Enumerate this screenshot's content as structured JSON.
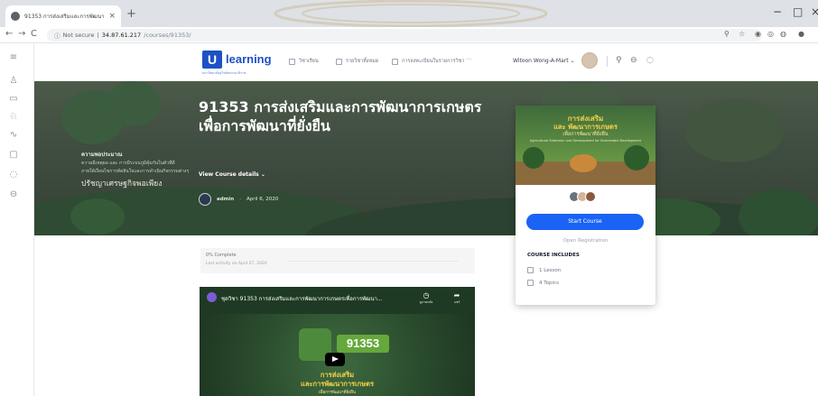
{
  "browser": {
    "tab_title": "91353 การส่งเสริมและการพัฒนาการ",
    "tab_close": "×",
    "new_tab": "+",
    "back": "←",
    "forward": "→",
    "reload": "C",
    "security": "Not secure",
    "url_host": "34.87.61.217",
    "url_path": "/courses/91353/",
    "window": {
      "minimize": "−",
      "maximize": "□",
      "close": "×"
    }
  },
  "header": {
    "logo_letter": "U",
    "logo_word": "learning",
    "logo_sub": "มหาวิทยาลัยสุโขทัยธรรมาธิราช",
    "nav": [
      {
        "label": "วิชาเรียน"
      },
      {
        "label": "รายวิชาทั้งหมด"
      },
      {
        "label": "การลงทะเบียนในรายการวิชา"
      }
    ],
    "more": "···",
    "user_name": "Witoon Wong-A-Mart",
    "user_caret": "⌄"
  },
  "hero": {
    "left_line1": "ความพอประมาณ",
    "left_line2": "ความมีเหตุผล และ การมีระบบภูมิคุ้มกันในตัวที่ดี",
    "left_line3": "ภายใต้เงื่อนไขการตัดสินใจและการดำเนินกิจกรรมต่างๆ",
    "left_line4": "ปรัชญาเศรษฐกิจพอเพียง",
    "title": "91353 การส่งเสริมและการพัฒนาการเกษตรเพื่อการพัฒนาที่ยั่งยืน",
    "view_details": "View Course details",
    "view_caret": "⌄",
    "author": "admin",
    "date_sep": "·",
    "date": "April 6, 2020"
  },
  "card": {
    "img_line1": "การส่งเสริม",
    "img_line2": "และ พัฒนาการเกษตร",
    "img_line3": "เพื่อการพัฒนาที่ยั่งยืน",
    "img_line4": "Agricultural Extension and Development for Sustainable Development",
    "start_button": "Start Course",
    "open_registration": "Open Registration",
    "includes_heading": "COURSE INCLUDES",
    "includes": [
      {
        "label": "1 Lesson"
      },
      {
        "label": "4 Topics"
      }
    ]
  },
  "progress": {
    "percent_label": "0% Complete",
    "percent_value": 0,
    "last_activity": "Last activity on April 27, 2020"
  },
  "video": {
    "title": "ชุดวิชา 91353 การส่งเสริมและการพัฒนาการเกษตรเพื่อการพัฒนา...",
    "watch_later": "ดูภายหลัง",
    "share": "แชร์",
    "code": "91353",
    "line1": "การส่งเสริม",
    "line2": "และการพัฒนาการเกษตร",
    "line3": "เพื่อการพัฒนาที่ยั่งยืน"
  },
  "colors": {
    "brand": "#1d51c4",
    "primary_button": "#1a63f5",
    "hero_bg": "#3f4c40",
    "accent_yellow": "#f6d04b"
  },
  "icons": {
    "sidenav": [
      "menu-icon",
      "user-icon",
      "course-icon",
      "group-icon",
      "activity-icon",
      "message-icon",
      "notification-icon",
      "cart-icon"
    ],
    "header": [
      "search-icon",
      "cart-icon",
      "bell-icon"
    ]
  }
}
